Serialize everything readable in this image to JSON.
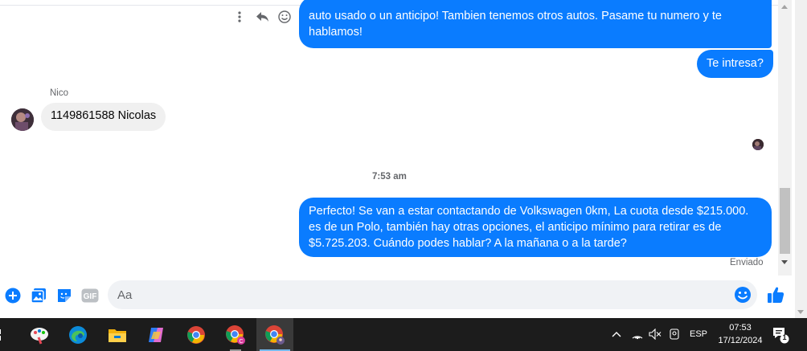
{
  "messages": {
    "top_partial": "auto usado o un anticipo! Tambien tenemos otros autos. Pasame tu numero y te hablamos!",
    "intresa": "Te intresa?",
    "sender_name": "Nico",
    "nico_reply": "1149861588 Nicolas",
    "timestamp": "7:53 am",
    "perfecto": "Perfecto!  Se van a estar contactando de Volkswagen 0km, La cuota desde $215.000. es de un Polo, también hay otras opciones, el anticipo mínimo para retirar es de $5.725.203. Cuándo podes hablar? A la mañana o a la tarde?",
    "status": "Enviado"
  },
  "composer": {
    "placeholder": "Aa",
    "icons": [
      "plus-circle-icon",
      "gallery-icon",
      "sticker-icon",
      "gif-icon",
      "emoji-icon",
      "thumbs-up-icon"
    ]
  },
  "taskbar": {
    "apps": [
      "start-icon",
      "paint-icon",
      "edge-icon",
      "file-explorer-icon",
      "copilot-icon",
      "chrome-icon",
      "chrome-profile-c-icon",
      "chrome-profile-active-icon"
    ],
    "tray": {
      "language": "ESP",
      "time": "07:53",
      "date": "17/12/2024",
      "notification_count": "1"
    }
  },
  "colors": {
    "outgoing_bubble": "#0a7cff",
    "incoming_bubble": "#f0f0f0",
    "accent": "#0a7cff",
    "taskbar": "#1c1c1c"
  }
}
